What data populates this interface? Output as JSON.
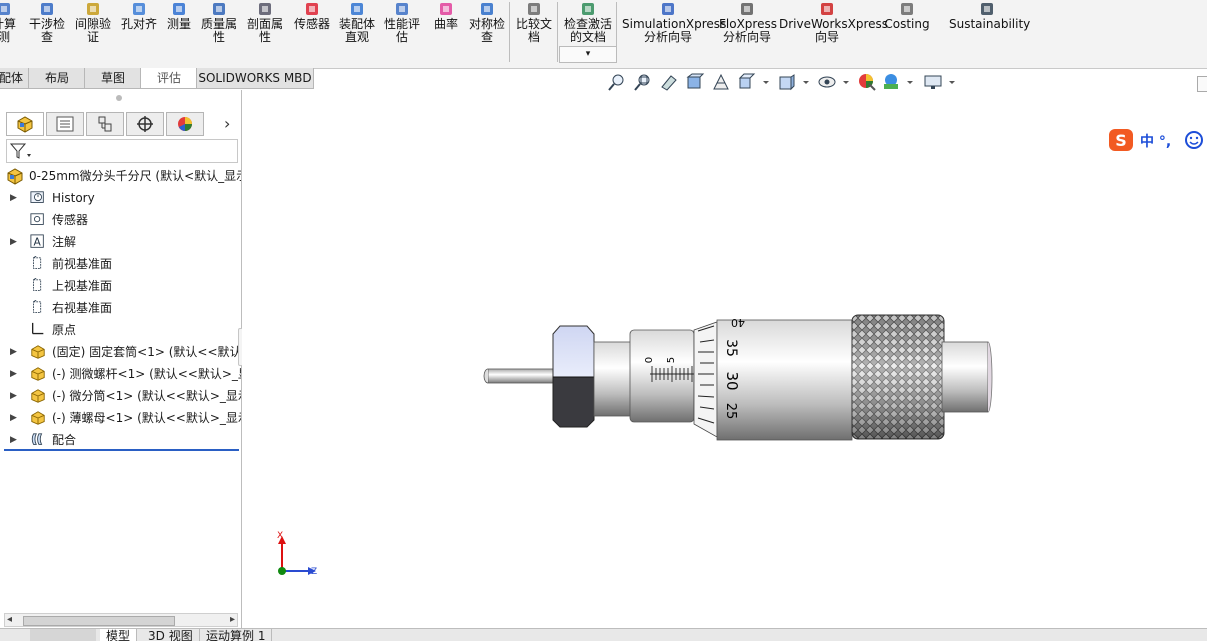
{
  "ribbon": {
    "items": [
      {
        "label": "计算\n测",
        "icon": "calculator-icon"
      },
      {
        "label": "干涉检\n查",
        "icon": "interference-icon"
      },
      {
        "label": "间隙验\n证",
        "icon": "clearance-icon"
      },
      {
        "label": "孔对齐",
        "icon": "hole-align-icon"
      },
      {
        "label": "测量",
        "icon": "measure-icon"
      },
      {
        "label": "质量属\n性",
        "icon": "mass-properties-icon"
      },
      {
        "label": "剖面属\n性",
        "icon": "section-properties-icon"
      },
      {
        "label": "传感器",
        "icon": "sensor-icon"
      },
      {
        "label": "装配体\n直观",
        "icon": "assembly-visualization-icon"
      },
      {
        "label": "性能评\n估",
        "icon": "performance-icon"
      },
      {
        "label": "曲率",
        "icon": "curvature-icon"
      },
      {
        "label": "对称检\n查",
        "icon": "symmetry-icon"
      },
      {
        "label": "比较文\n档",
        "icon": "compare-icon"
      },
      {
        "label": "检查激活\n的文档",
        "icon": "check-active-doc-icon"
      },
      {
        "label": "SimulationXpress\n分析向导",
        "icon": "simulationxpress-icon"
      },
      {
        "label": "FloXpress\n分析向导",
        "icon": "floxpress-icon"
      },
      {
        "label": "DriveWorksXpress\n向导",
        "icon": "driveworksxpress-icon"
      },
      {
        "label": "Costing",
        "icon": "costing-icon"
      },
      {
        "label": "Sustainability",
        "icon": "sustainability-icon"
      }
    ]
  },
  "command_tabs": [
    "配体",
    "布局",
    "草图",
    "评估",
    "SOLIDWORKS MBD"
  ],
  "active_tab_index": 3,
  "feature_tree": {
    "root": "0-25mm微分头千分尺  (默认<默认_显示",
    "items": [
      {
        "label": "History",
        "icon": "history-icon",
        "expandable": true
      },
      {
        "label": "传感器",
        "icon": "sensor-folder-icon",
        "expandable": false
      },
      {
        "label": "注解",
        "icon": "annotation-icon",
        "expandable": true
      },
      {
        "label": "前视基准面",
        "icon": "plane-icon",
        "expandable": false
      },
      {
        "label": "上视基准面",
        "icon": "plane-icon",
        "expandable": false
      },
      {
        "label": "右视基准面",
        "icon": "plane-icon",
        "expandable": false
      },
      {
        "label": "原点",
        "icon": "origin-icon",
        "expandable": false
      },
      {
        "label": "(固定) 固定套筒<1> (默认<<默认>_",
        "icon": "part-icon",
        "expandable": true
      },
      {
        "label": "(-) 测微螺杆<1> (默认<<默认>_显示",
        "icon": "part-icon",
        "expandable": true
      },
      {
        "label": "(-) 微分筒<1> (默认<<默认>_显示",
        "icon": "part-icon",
        "expandable": true
      },
      {
        "label": "(-) 薄螺母<1> (默认<<默认>_显示",
        "icon": "part-icon",
        "expandable": true
      },
      {
        "label": "配合",
        "icon": "mates-icon",
        "expandable": true
      }
    ]
  },
  "bottom_tabs": [
    "模型",
    "3D 视图",
    "运动算例 1"
  ],
  "viewport": {
    "scale_numbers": [
      "40",
      "35",
      "30",
      "25"
    ],
    "sleeve_numbers": [
      "0",
      "5"
    ],
    "triad": {
      "x": "X",
      "z": "Z"
    }
  },
  "ime": {
    "text": "中 °, "
  }
}
